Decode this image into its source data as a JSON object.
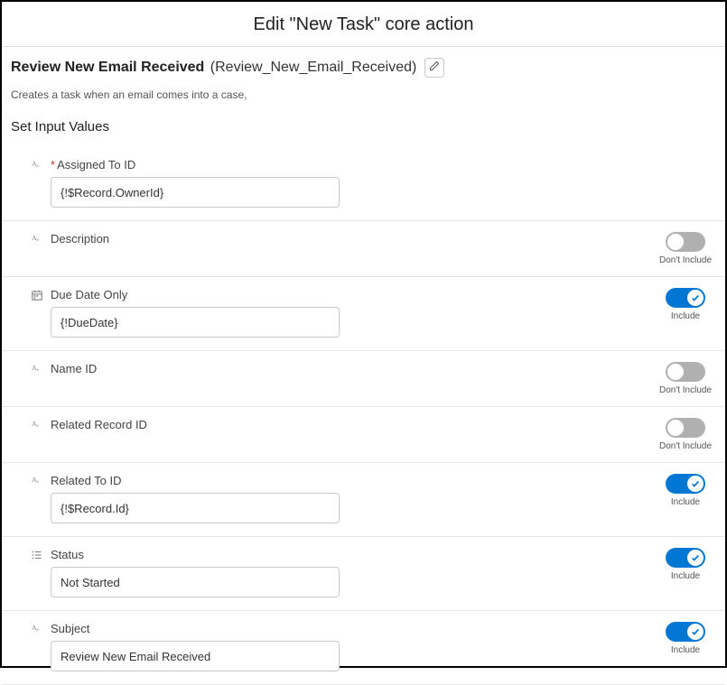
{
  "title": "Edit \"New Task\" core action",
  "header": {
    "label": "Review New Email Received",
    "api_name": "(Review_New_Email_Received)"
  },
  "description": "Creates a task when an email comes into a case,",
  "section_title": "Set Input Values",
  "toggle_labels": {
    "on": "Include",
    "off": "Don't Include"
  },
  "fields": [
    {
      "icon": "text",
      "required": true,
      "label": "Assigned To ID",
      "value": "{!$Record.OwnerId}",
      "toggle": null
    },
    {
      "icon": "text",
      "required": false,
      "label": "Description",
      "value": null,
      "toggle": "off"
    },
    {
      "icon": "date",
      "required": false,
      "label": "Due Date Only",
      "value": "{!DueDate}",
      "toggle": "on"
    },
    {
      "icon": "text",
      "required": false,
      "label": "Name ID",
      "value": null,
      "toggle": "off"
    },
    {
      "icon": "text",
      "required": false,
      "label": "Related Record ID",
      "value": null,
      "toggle": "off"
    },
    {
      "icon": "text",
      "required": false,
      "label": "Related To ID",
      "value": "{!$Record.Id}",
      "toggle": "on"
    },
    {
      "icon": "list",
      "required": false,
      "label": "Status",
      "value": "Not Started",
      "toggle": "on"
    },
    {
      "icon": "text",
      "required": false,
      "label": "Subject",
      "value": "Review New Email Received",
      "toggle": "on"
    }
  ]
}
